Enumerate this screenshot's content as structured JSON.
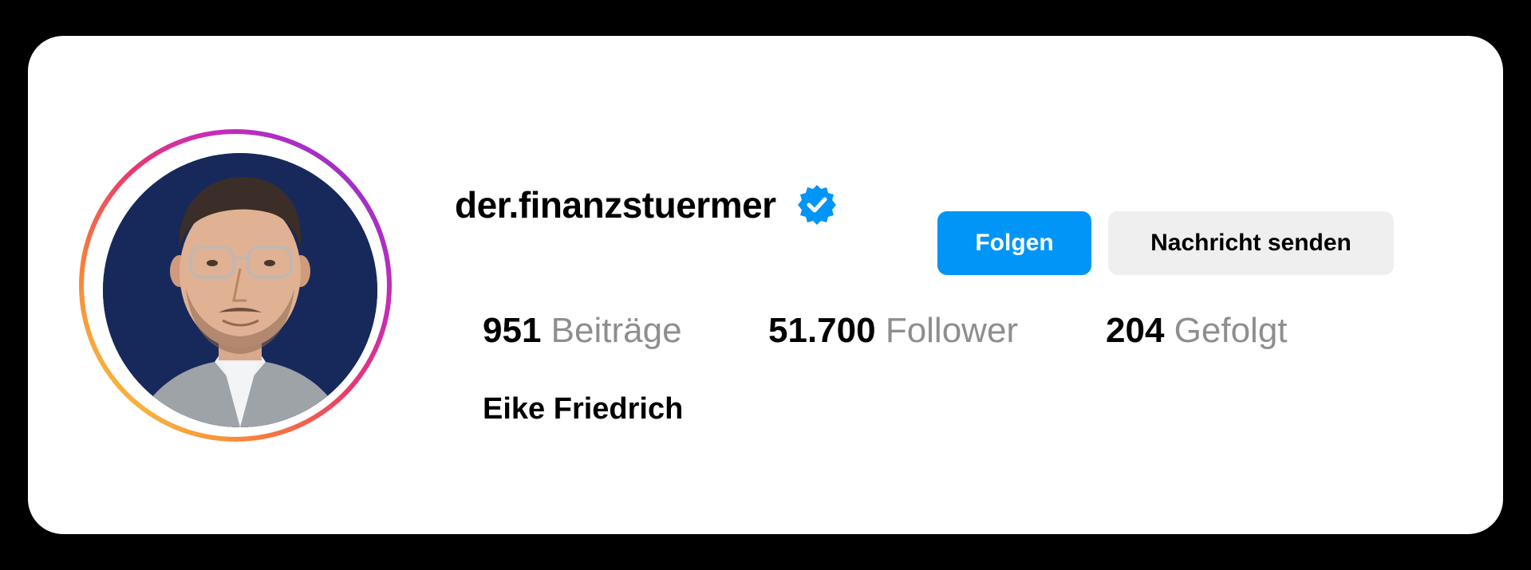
{
  "profile": {
    "username": "der.finanzstuermer",
    "full_name": "Eike Friedrich",
    "verified": true,
    "avatar_icon": "profile-photo"
  },
  "actions": {
    "follow_label": "Folgen",
    "message_label": "Nachricht senden"
  },
  "stats": {
    "posts": {
      "value": "951",
      "label": "Beiträge"
    },
    "followers": {
      "value": "51.700",
      "label": "Follower"
    },
    "following": {
      "value": "204",
      "label": "Gefolgt"
    }
  },
  "colors": {
    "follow_button": "#0095f6",
    "message_button": "#efefef",
    "verified_badge": "#0095f6",
    "muted_text": "#8e8e8e",
    "avatar_background": "#17295a"
  }
}
